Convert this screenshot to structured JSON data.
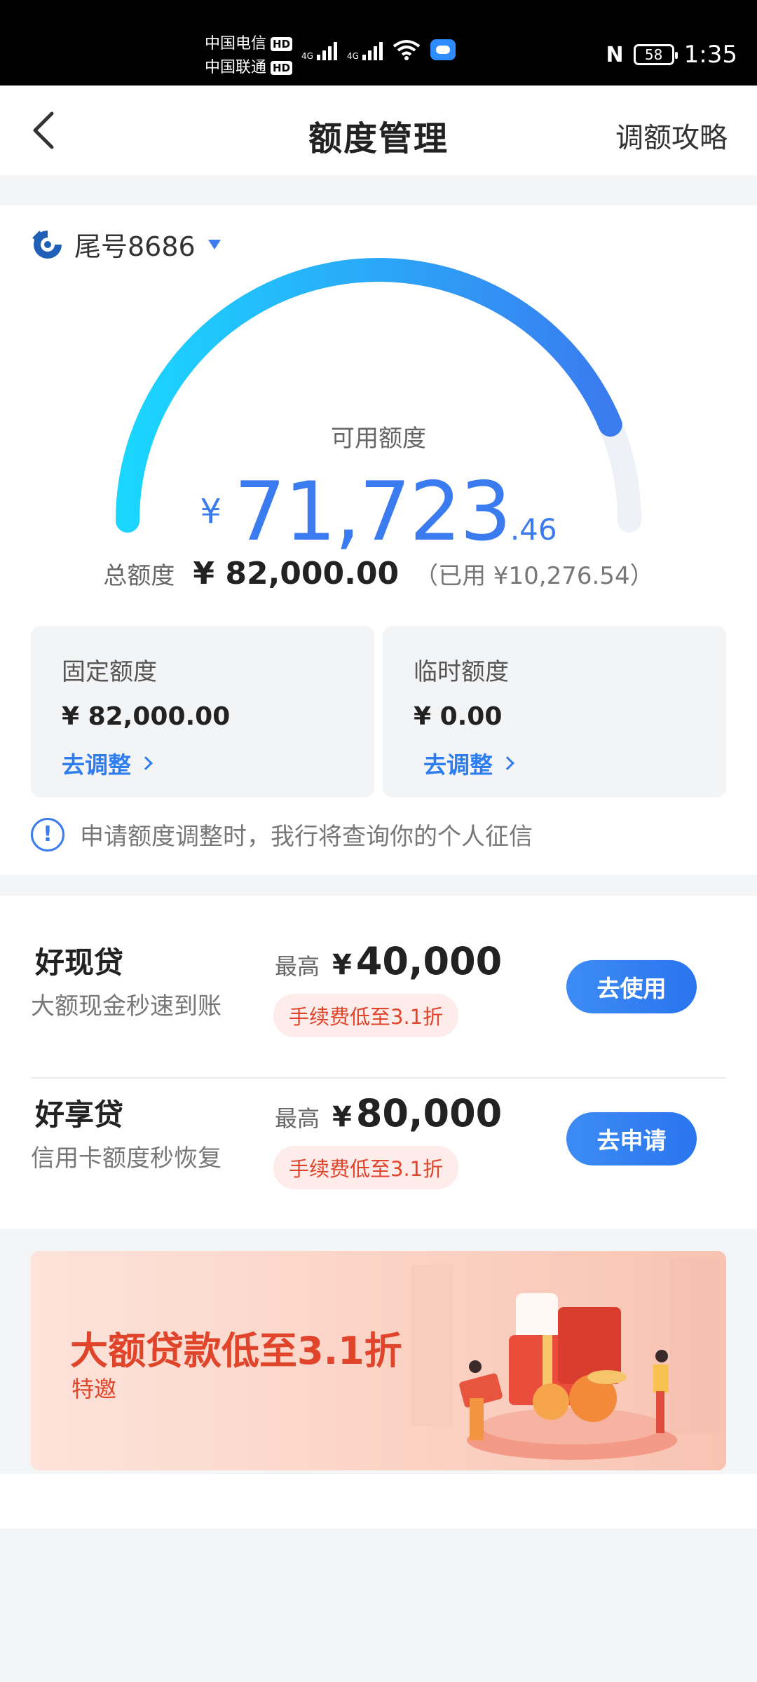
{
  "status_bar": {
    "carrier1": "中国电信",
    "carrier2": "中国联通",
    "hd_label": "HD",
    "network": "4G",
    "nfc": "N",
    "battery": "58",
    "time": "1:35"
  },
  "header": {
    "title": "额度管理",
    "right_link": "调额攻略"
  },
  "account": {
    "label": "尾号8686"
  },
  "available": {
    "label": "可用额度",
    "currency": "¥",
    "integer": "71,723",
    "decimal": ".46",
    "fraction_of_total": 0.875
  },
  "total": {
    "label": "总额度",
    "value": "¥ 82,000.00",
    "used": "（已用 ¥10,276.54）"
  },
  "fixed_quota": {
    "label": "固定额度",
    "value": "¥ 82,000.00",
    "link": "去调整"
  },
  "temp_quota": {
    "label": "临时额度",
    "value": "¥ 0.00",
    "link": "去调整"
  },
  "notice": {
    "icon": "!",
    "text": "申请额度调整时，我行将查询你的个人征信"
  },
  "loans": [
    {
      "name": "好现贷",
      "desc": "大额现金秒速到账",
      "max_label": "最高",
      "currency": "¥",
      "amount": "40,000",
      "fee": "手续费低至3.1折",
      "button": "去使用"
    },
    {
      "name": "好享贷",
      "desc": "信用卡额度秒恢复",
      "max_label": "最高",
      "currency": "¥",
      "amount": "80,000",
      "fee": "手续费低至3.1折",
      "button": "去申请"
    }
  ],
  "banner": {
    "title": "大额贷款低至3.1折",
    "subtitle": "特邀"
  },
  "colors": {
    "accent": "#3a7bf0",
    "promo": "#e0452c",
    "gauge_start": "#1ad6ff",
    "gauge_end": "#3a7bf0",
    "gauge_track": "#eef1f8"
  }
}
